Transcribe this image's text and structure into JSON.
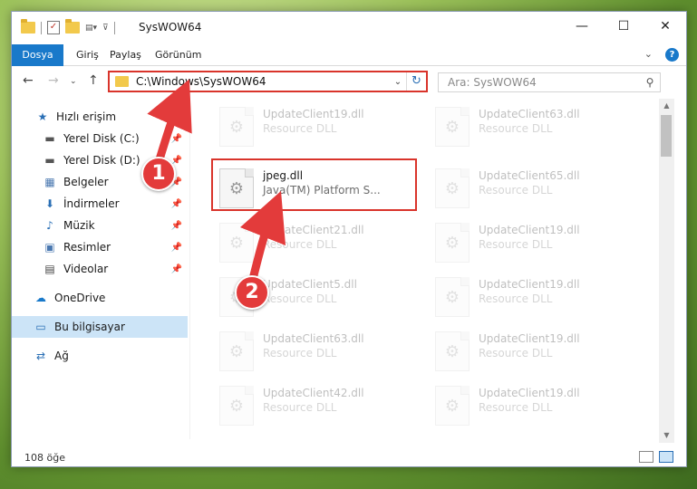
{
  "window": {
    "title": "SysWOW64"
  },
  "ribbon": {
    "tabs": [
      "Dosya",
      "Giriş",
      "Paylaş",
      "Görünüm"
    ]
  },
  "address": {
    "path": "C:\\Windows\\SysWOW64"
  },
  "search": {
    "placeholder": "Ara: SysWOW64"
  },
  "sidebar": {
    "items": [
      {
        "label": "Hızlı erişim",
        "icon": "star-icon"
      },
      {
        "label": "Yerel Disk (C:)",
        "icon": "drive-icon",
        "pinned": true
      },
      {
        "label": "Yerel Disk (D:)",
        "icon": "drive-icon",
        "pinned": true
      },
      {
        "label": "Belgeler",
        "icon": "documents-icon",
        "pinned": true
      },
      {
        "label": "İndirmeler",
        "icon": "download-icon",
        "pinned": true
      },
      {
        "label": "Müzik",
        "icon": "music-icon",
        "pinned": true
      },
      {
        "label": "Resimler",
        "icon": "pictures-icon",
        "pinned": true
      },
      {
        "label": "Videolar",
        "icon": "videos-icon",
        "pinned": true
      },
      {
        "label": "OneDrive",
        "icon": "cloud-icon"
      },
      {
        "label": "Bu bilgisayar",
        "icon": "computer-icon",
        "selected": true
      },
      {
        "label": "Ağ",
        "icon": "network-icon"
      }
    ]
  },
  "files": {
    "left": [
      {
        "name": "UpdateClient19.dll",
        "desc": "Resource DLL"
      },
      {
        "name": "jpeg.dll",
        "desc": "Java(TM) Platform S..."
      },
      {
        "name": "UpdateClient21.dll",
        "desc": "Resource DLL"
      },
      {
        "name": "UpdateClient5.dll",
        "desc": "Resource DLL"
      },
      {
        "name": "UpdateClient63.dll",
        "desc": "Resource DLL"
      },
      {
        "name": "UpdateClient42.dll",
        "desc": "Resource DLL"
      }
    ],
    "right": [
      {
        "name": "UpdateClient63.dll",
        "desc": "Resource DLL"
      },
      {
        "name": "UpdateClient65.dll",
        "desc": "Resource DLL"
      },
      {
        "name": "UpdateClient19.dll",
        "desc": "Resource DLL"
      },
      {
        "name": "UpdateClient19.dll",
        "desc": "Resource DLL"
      },
      {
        "name": "UpdateClient19.dll",
        "desc": "Resource DLL"
      },
      {
        "name": "UpdateClient19.dll",
        "desc": "Resource DLL"
      }
    ]
  },
  "status": {
    "count": "108 öğe"
  },
  "annotations": {
    "step1": "1",
    "step2": "2",
    "color": "#e33b3b"
  }
}
